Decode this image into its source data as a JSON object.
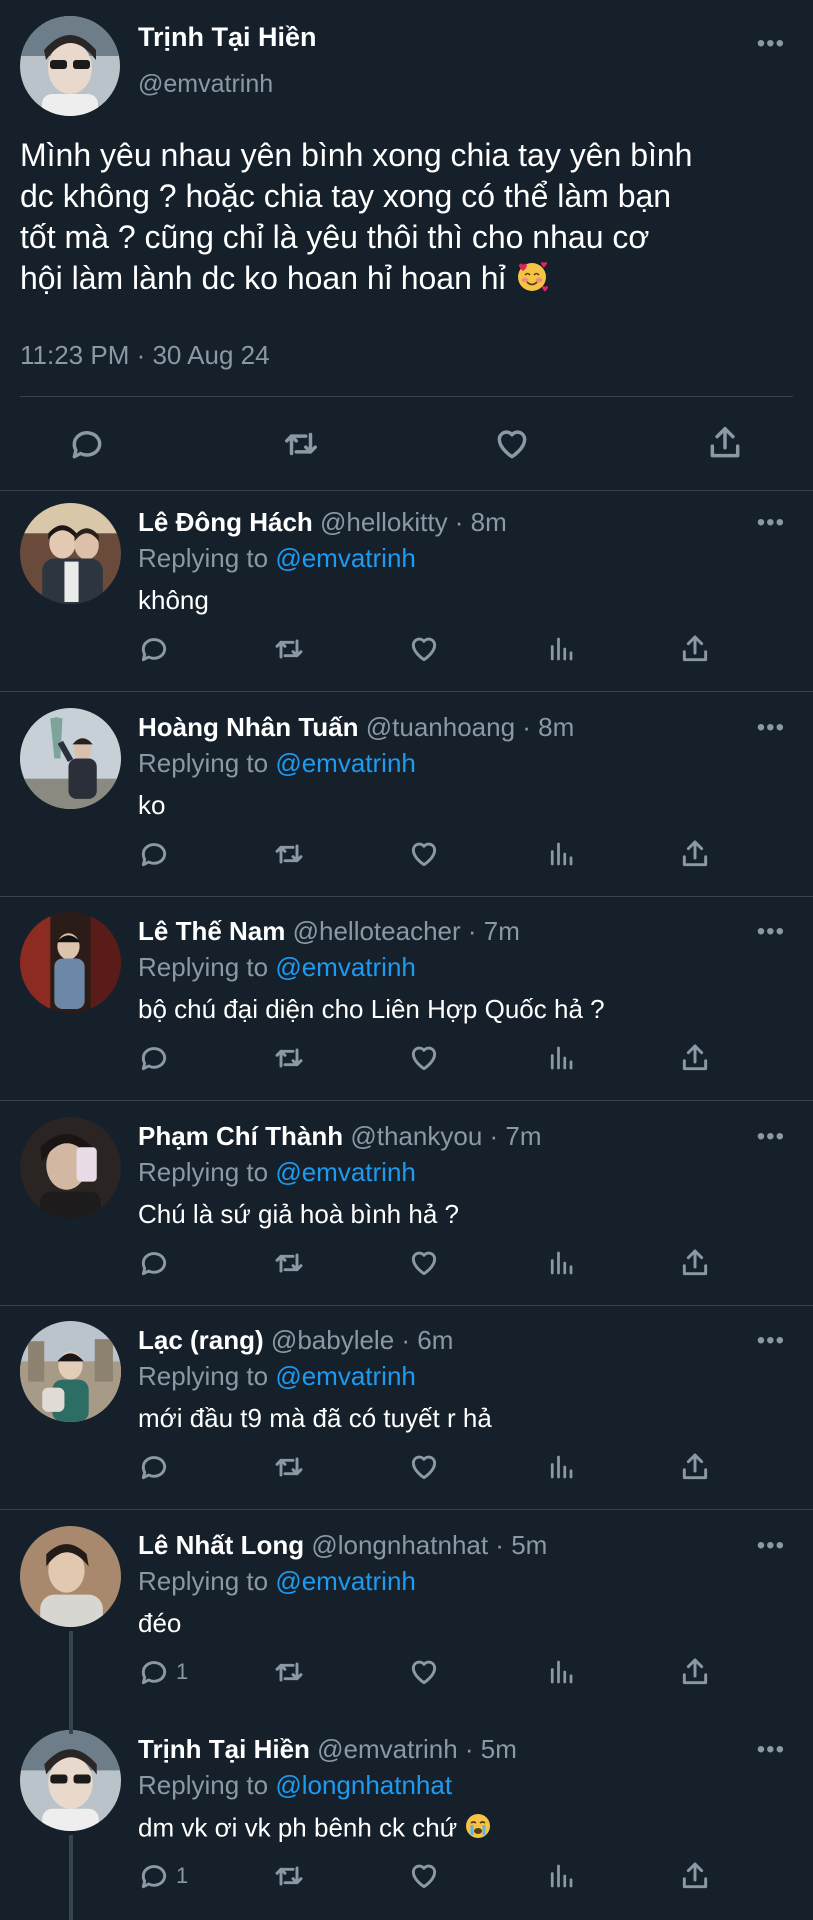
{
  "main_tweet": {
    "name": "Trịnh Tại Hiền",
    "handle": "@emvatrinh",
    "text_lines": [
      "Mình yêu nhau yên bình xong chia tay yên bình",
      "dc không ? hoặc chia tay xong có thể làm bạn",
      "tốt mà ? cũng chỉ là yêu thôi thì cho nhau cơ",
      "hội làm lành dc ko hoan hỉ hoan hỉ"
    ],
    "emoji": "smiling-face-with-hearts",
    "timestamp": "11:23 PM · 30 Aug 24",
    "more_label": "•••",
    "actions": [
      "reply-icon",
      "retweet-icon",
      "like-icon",
      "share-icon"
    ]
  },
  "replying_to_label": "Replying to",
  "replies": [
    {
      "name": "Lê Đông Hách",
      "meta": "@hellokitty · 8m",
      "mention": "@emvatrinh",
      "text": "không",
      "reply_count": ""
    },
    {
      "name": "Hoàng Nhân Tuấn",
      "meta": "@tuanhoang · 8m",
      "mention": "@emvatrinh",
      "text": "ko",
      "reply_count": ""
    },
    {
      "name": "Lê Thế Nam",
      "meta": "@helloteacher · 7m",
      "mention": "@emvatrinh",
      "text": "bộ chú đại diện cho Liên Hợp Quốc hả ?",
      "reply_count": ""
    },
    {
      "name": "Phạm Chí Thành",
      "meta": "@thankyou · 7m",
      "mention": "@emvatrinh",
      "text": "Chú là sứ giả hoà bình hả ?",
      "reply_count": ""
    },
    {
      "name": "Lạc (rang)",
      "meta": "@babylele · 6m",
      "mention": "@emvatrinh",
      "text": "mới đầu t9 mà đã có tuyết r hả",
      "reply_count": ""
    },
    {
      "name": "Lê Nhất Long",
      "meta": "@longnhatnhat · 5m",
      "mention": "@emvatrinh",
      "text": "đéo",
      "reply_count": "1"
    },
    {
      "name": "Trịnh Tại Hiền",
      "meta": "@emvatrinh · 5m",
      "mention": "@longnhatnhat",
      "text": "dm vk ơi vk ph bênh ck chứ",
      "reply_count": "1"
    }
  ],
  "more_label": "•••",
  "colors": {
    "background": "#15202b",
    "secondary_text": "#8b98a5",
    "link": "#1d9bf0",
    "divider": "#38444d"
  }
}
